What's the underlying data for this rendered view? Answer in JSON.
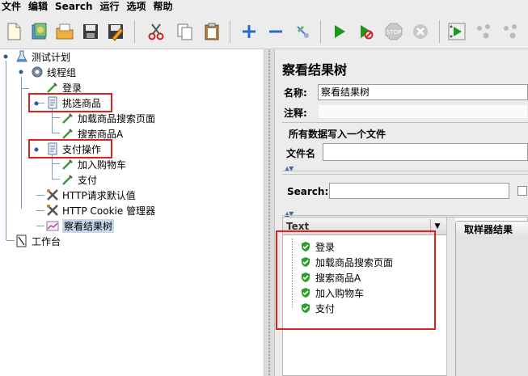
{
  "menu": [
    "文件",
    "编辑",
    "Search",
    "运行",
    "选项",
    "帮助"
  ],
  "toolbar_icons": [
    "new-icon",
    "templates-icon",
    "open-icon",
    "save-icon",
    "save-as-icon",
    "cut-icon",
    "copy-icon",
    "paste-icon",
    "expand-icon",
    "collapse-icon",
    "toggle-icon",
    "start-icon",
    "start-no-pause-icon",
    "stop-icon",
    "shutdown-icon",
    "remote-start-icon",
    "remote-stop-icon",
    "remote-exit-icon"
  ],
  "tree": {
    "root": "测试计划",
    "thread_group": "线程组",
    "login": "登录",
    "choose_goods": "挑选商品",
    "load_search": "加载商品搜索页面",
    "search_goods": "搜索商品A",
    "pay_op": "支付操作",
    "add_cart": "加入购物车",
    "pay": "支付",
    "http_defaults": "HTTP请求默认值",
    "cookie_manager": "HTTP Cookie 管理器",
    "result_tree": "察看结果树",
    "workbench": "工作台"
  },
  "panel": {
    "title": "察看结果树",
    "name_label": "名称:",
    "name_value": "察看结果树",
    "comment_label": "注释:",
    "comment_value": "",
    "file_section": "所有数据写入一个文件",
    "filename_label": "文件名",
    "filename_value": "",
    "search_label": "Search:",
    "search_value": "",
    "text_header": "Text",
    "sampler_tab": "取样器结果"
  },
  "results": [
    "登录",
    "加载商品搜索页面",
    "搜索商品A",
    "加入购物车",
    "支付"
  ],
  "colors": {
    "highlight_box": "#e02020",
    "success_shield": "#2aa02a",
    "selection": "#c8d8ec"
  }
}
